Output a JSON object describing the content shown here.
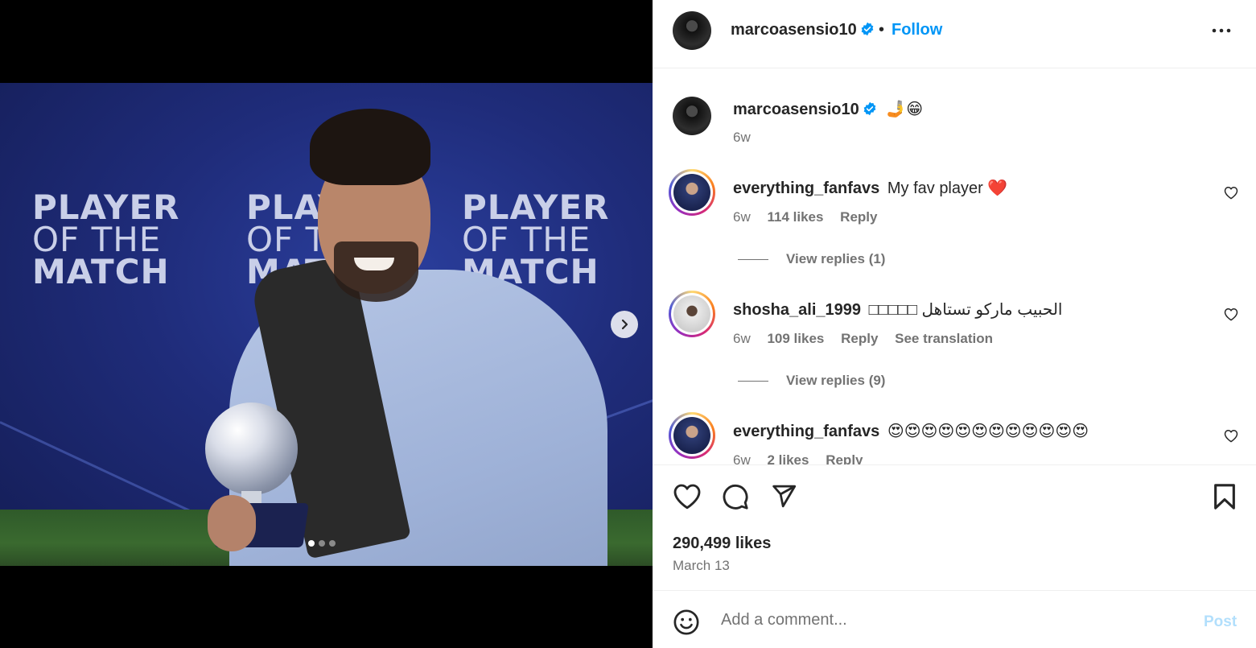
{
  "post": {
    "username": "marcoasensio10",
    "follow_label": "Follow",
    "bullet": "•",
    "caption_emoji": "🤳😁",
    "caption_time": "6w",
    "likes": "290,499 likes",
    "date": "March 13"
  },
  "media": {
    "banner_lines": [
      "PLAYER",
      "OF THE",
      "MATCH"
    ],
    "slide_count": 3,
    "active_slide": 1
  },
  "comments": [
    {
      "username": "everything_fanfavs",
      "text": "My fav player ❤️",
      "time": "6w",
      "likes": "114 likes",
      "reply": "Reply",
      "view_replies": "View replies (1)"
    },
    {
      "username": "shosha_ali_1999",
      "text": "⁣□□□□□ الحبيب ماركو تستاهل",
      "time": "6w",
      "likes": "109 likes",
      "reply": "Reply",
      "translation": "See translation",
      "view_replies": "View replies (9)"
    },
    {
      "username": "everything_fanfavs",
      "text": "😍😍😍😍😍😍😍😍😍😍😍😍",
      "time": "6w",
      "likes": "2 likes",
      "reply": "Reply"
    }
  ],
  "composer": {
    "placeholder": "Add a comment...",
    "post_label": "Post"
  },
  "colors": {
    "accent": "#0095f6",
    "verified": "#0095f6",
    "muted": "#737373",
    "post_disabled": "#b2dffc"
  },
  "icons": [
    "verified-badge-icon",
    "more-options-icon",
    "next-arrow-icon",
    "heart-icon",
    "comment-icon",
    "share-icon",
    "bookmark-icon",
    "emoji-icon"
  ]
}
